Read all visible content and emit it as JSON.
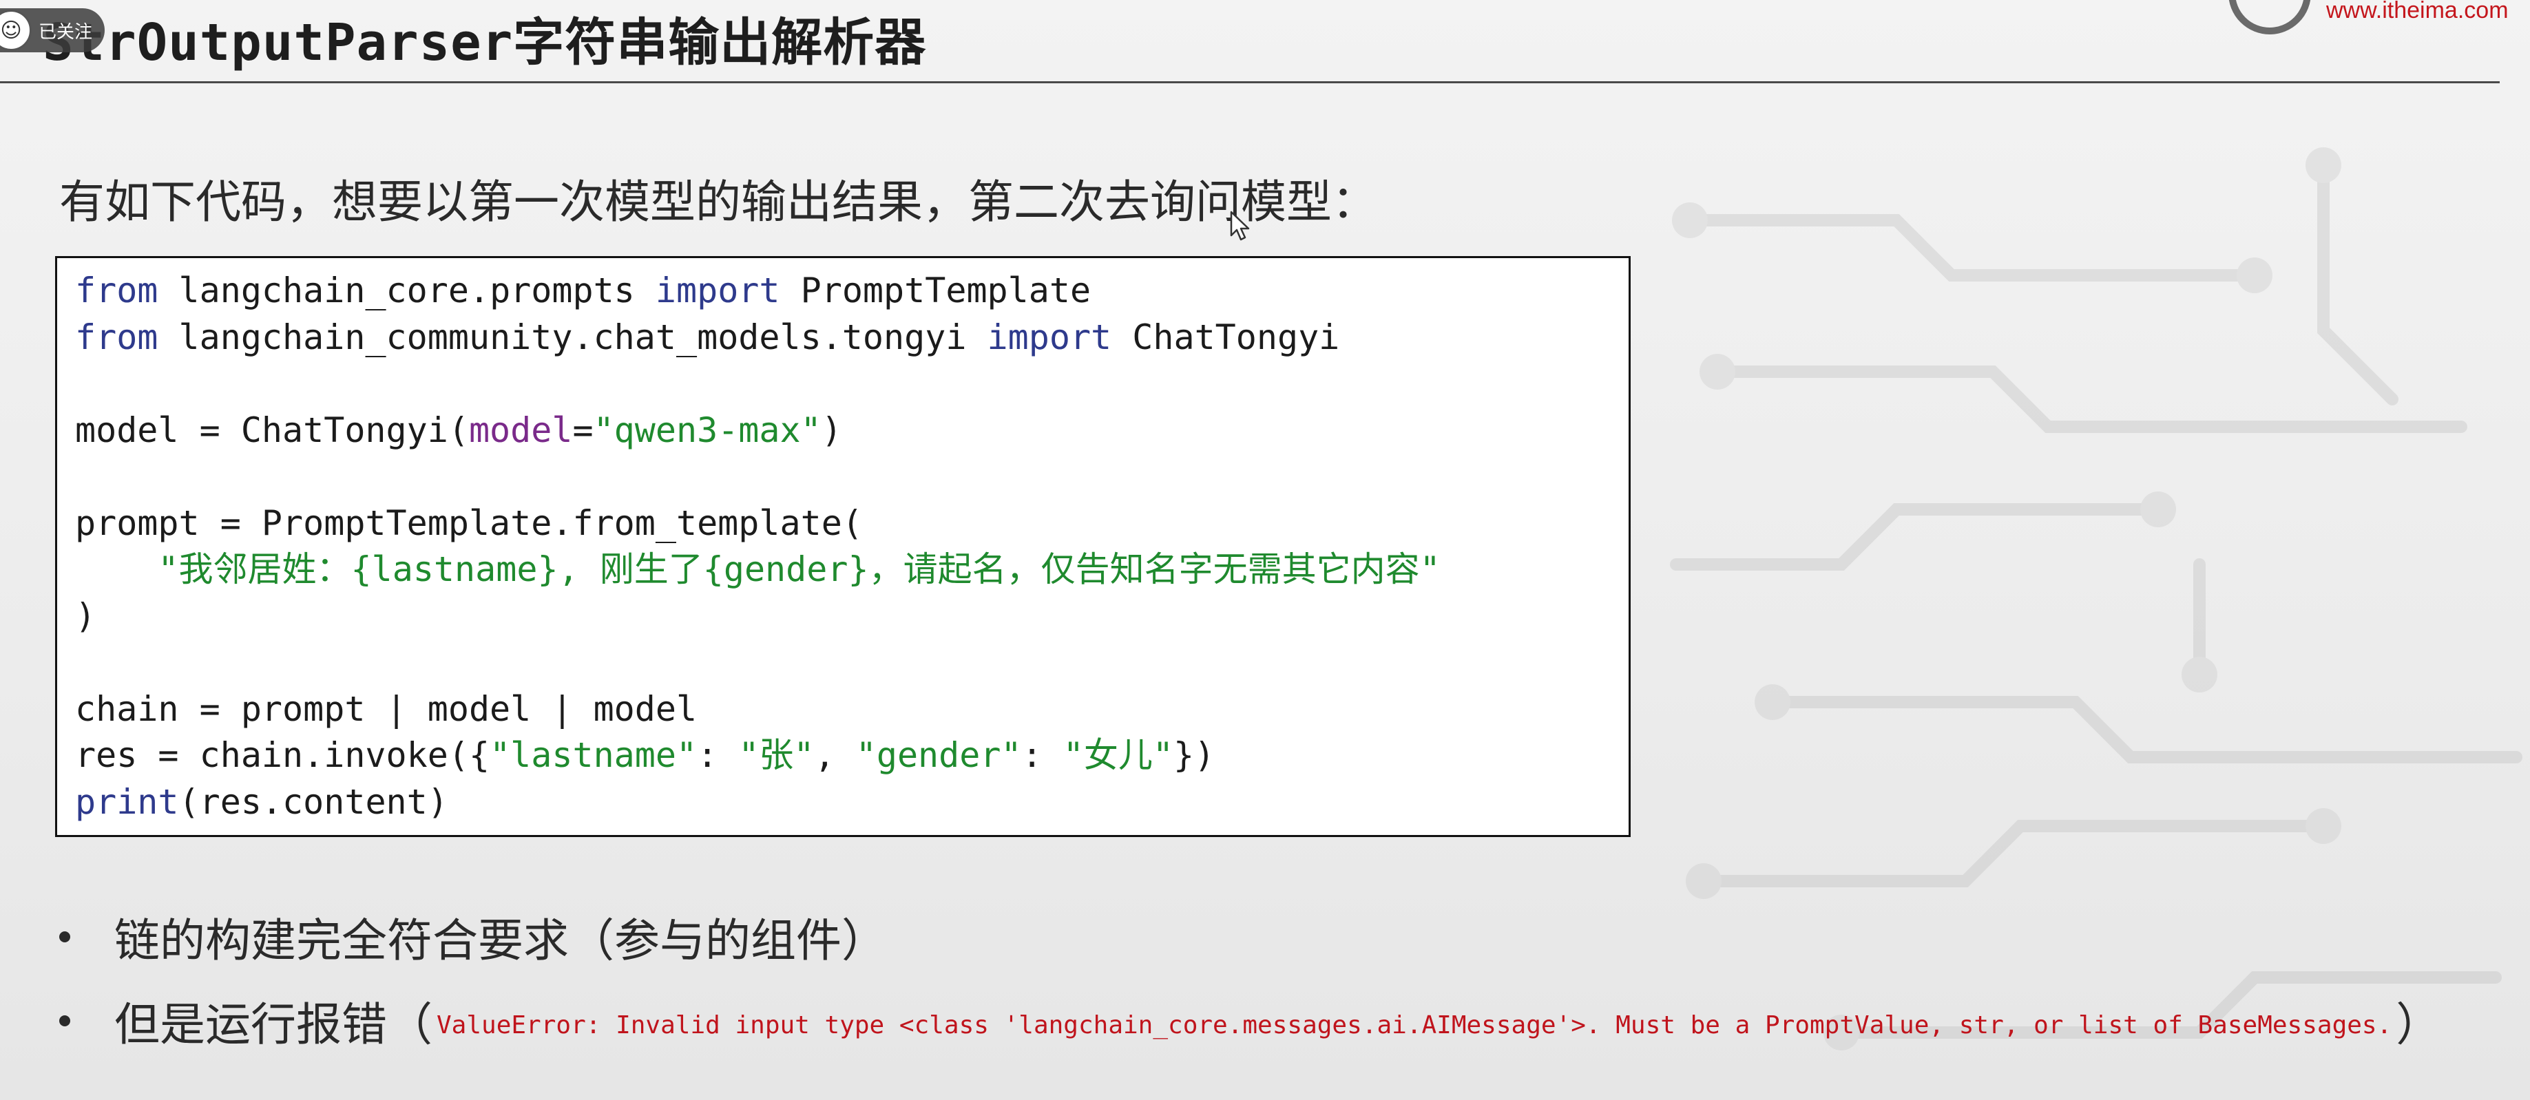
{
  "header": {
    "title": "StrOutputParser字符串输出解析器",
    "follow_label": "已关注",
    "logo_url": "www.itheima.com"
  },
  "intro": "有如下代码，想要以第一次模型的输出结果，第二次去询问模型：",
  "code": {
    "line1": {
      "kw1": "from",
      "mod": " langchain_core.prompts ",
      "kw2": "import",
      "name": " PromptTemplate"
    },
    "line2": {
      "kw1": "from",
      "mod": " langchain_community.chat_models.tongyi ",
      "kw2": "import",
      "name": " ChatTongyi"
    },
    "line4": {
      "pre": "model = ChatTongyi(",
      "param": "model",
      "eq": "=",
      "str": "\"qwen3-max\"",
      "post": ")"
    },
    "line6": "prompt = PromptTemplate.from_template(",
    "line7": {
      "indent": "    ",
      "str": "\"我邻居姓：{lastname}, 刚生了{gender}，请起名，仅告知名字无需其它内容\""
    },
    "line8": ")",
    "line10": "chain = prompt | model | model",
    "line11": {
      "pre": "res = chain.invoke({",
      "k1": "\"lastname\"",
      "c1": ": ",
      "v1": "\"张\"",
      "sep": ", ",
      "k2": "\"gender\"",
      "c2": ": ",
      "v2": "\"女儿\"",
      "post": "})"
    },
    "line12": {
      "kw": "print",
      "rest": "(res.content)"
    }
  },
  "bullets": {
    "b1": "链的构建完全符合要求（参与的组件）",
    "b2_prefix": "但是运行报错",
    "b2_open": "（",
    "b2_error": "ValueError: Invalid input type <class 'langchain_core.messages.ai.AIMessage'>. Must be a PromptValue, str, or list of BaseMessages.",
    "b2_close": "）"
  },
  "colors": {
    "keyword": "#2e3a8c",
    "string": "#1f8a2e",
    "param": "#7a2a8a",
    "error": "#c0141c"
  }
}
